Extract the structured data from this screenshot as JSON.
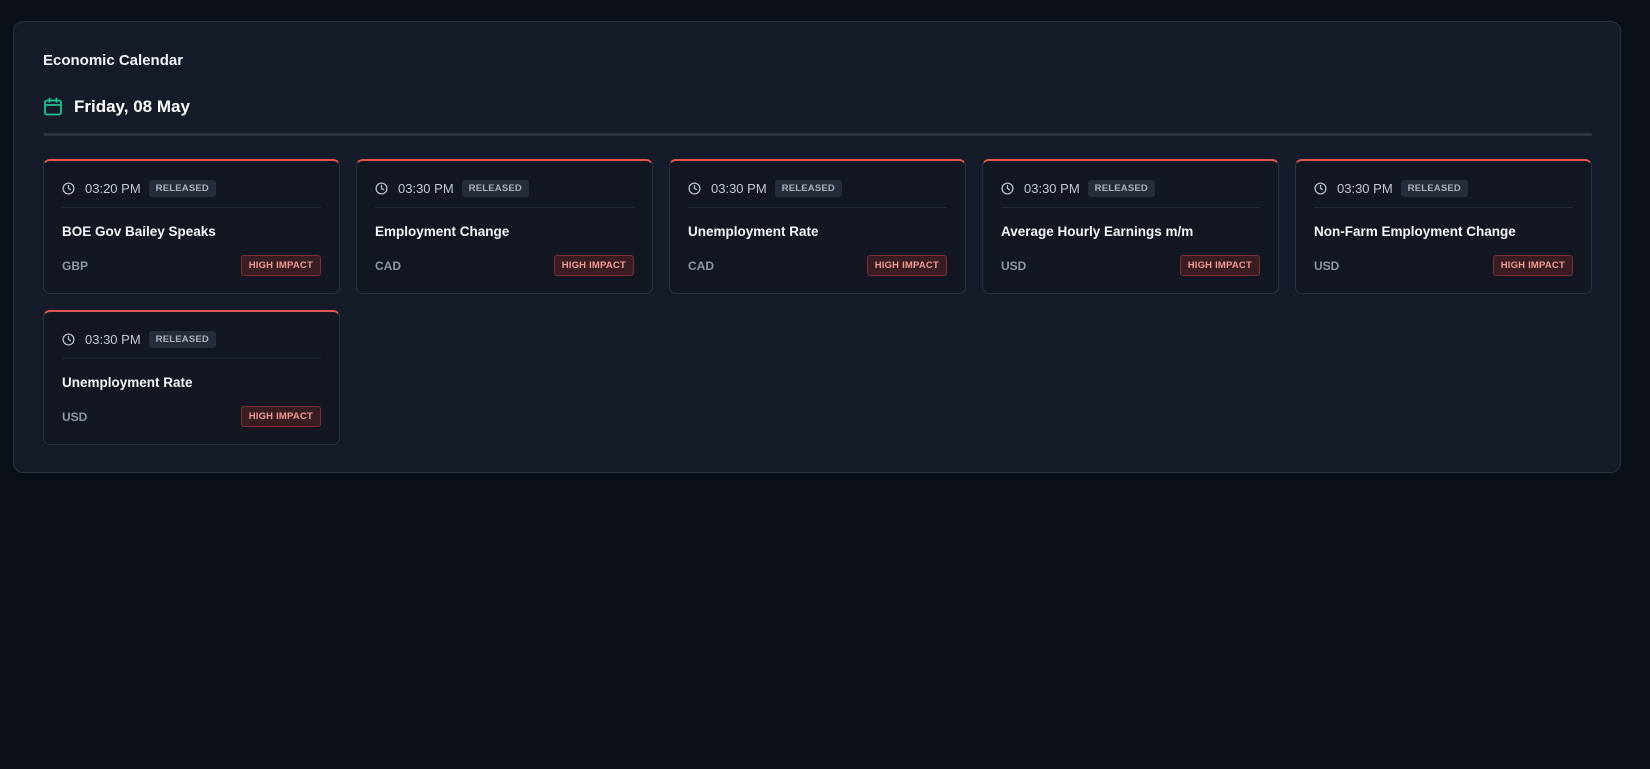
{
  "panel": {
    "title": "Economic Calendar"
  },
  "date": {
    "label": "Friday, 08 May",
    "icon": "calendar-icon"
  },
  "colors": {
    "accent": "#22c38e",
    "impact_high": "#e0574b"
  },
  "events": [
    {
      "time": "03:20 PM",
      "status": "RELEASED",
      "name": "BOE Gov Bailey Speaks",
      "currency": "GBP",
      "impact": "HIGH IMPACT"
    },
    {
      "time": "03:30 PM",
      "status": "RELEASED",
      "name": "Employment Change",
      "currency": "CAD",
      "impact": "HIGH IMPACT"
    },
    {
      "time": "03:30 PM",
      "status": "RELEASED",
      "name": "Unemployment Rate",
      "currency": "CAD",
      "impact": "HIGH IMPACT"
    },
    {
      "time": "03:30 PM",
      "status": "RELEASED",
      "name": "Average Hourly Earnings m/m",
      "currency": "USD",
      "impact": "HIGH IMPACT"
    },
    {
      "time": "03:30 PM",
      "status": "RELEASED",
      "name": "Non-Farm Employment Change",
      "currency": "USD",
      "impact": "HIGH IMPACT"
    },
    {
      "time": "03:30 PM",
      "status": "RELEASED",
      "name": "Unemployment Rate",
      "currency": "USD",
      "impact": "HIGH IMPACT"
    }
  ]
}
